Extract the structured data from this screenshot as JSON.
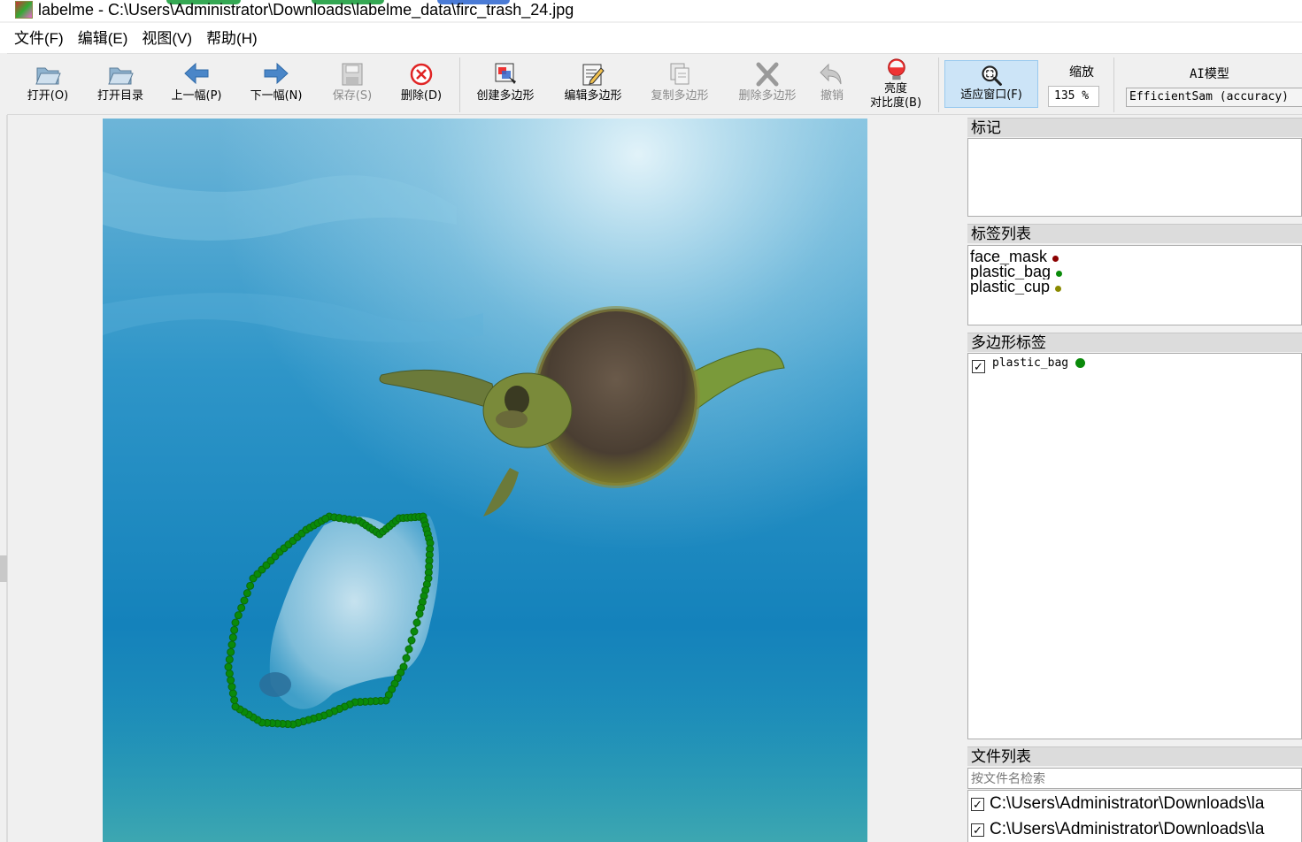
{
  "window": {
    "title": "labelme - C:\\Users\\Administrator\\Downloads\\labelme_data\\firc_trash_24.jpg"
  },
  "menu": [
    "文件(F)",
    "编辑(E)",
    "视图(V)",
    "帮助(H)"
  ],
  "toolbar": {
    "open": "打开(O)",
    "open_dir": "打开目录",
    "prev": "上一幅(P)",
    "next": "下一幅(N)",
    "save": "保存(S)",
    "delete": "删除(D)",
    "create_polygon": "创建多边形",
    "edit_polygon": "编辑多边形",
    "copy_polygon": "复制多边形",
    "delete_polygon": "删除多边形",
    "undo": "撤销",
    "brightness_1": "亮度",
    "brightness_2": "对比度(B)",
    "fit_window": "适应窗口(F)",
    "zoom_label": "缩放",
    "zoom_value": "135 %",
    "ai_label": "AI模型",
    "ai_model": "EfficientSam (accuracy)"
  },
  "panels": {
    "flags_title": "标记",
    "label_list_title": "标签列表",
    "labels": [
      {
        "name": "face_mask",
        "color": "#8b0000"
      },
      {
        "name": "plastic_bag",
        "color": "#0a8a0a"
      },
      {
        "name": "plastic_cup",
        "color": "#8a8a00"
      }
    ],
    "polygon_labels_title": "多边形标签",
    "polygons": [
      {
        "name": "plastic_bag",
        "checked": true,
        "color": "#0a8a0a"
      }
    ],
    "file_list_title": "文件列表",
    "file_search_placeholder": "按文件名检索",
    "files": [
      "C:\\Users\\Administrator\\Downloads\\la",
      "C:\\Users\\Administrator\\Downloads\\la"
    ]
  },
  "colors": {
    "annotation": "#0a8a0a",
    "water_top": "#6fb8da",
    "water_bottom": "#0c7fb8"
  }
}
